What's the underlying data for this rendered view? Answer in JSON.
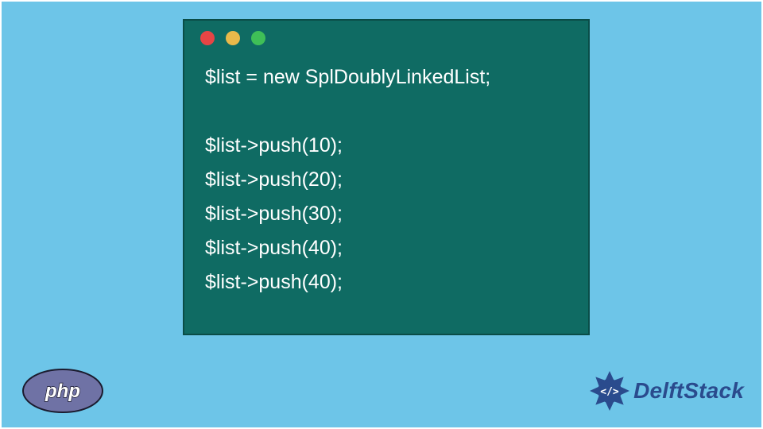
{
  "code": {
    "lines": [
      "$list = new SplDoublyLinkedList;",
      "",
      "$list->push(10);",
      "$list->push(20);",
      "$list->push(30);",
      "$list->push(40);",
      "$list->push(40);"
    ]
  },
  "badges": {
    "php_label": "php",
    "delft_label": "DelftStack"
  },
  "colors": {
    "canvas": "#6dc5e8",
    "window": "#0f6b63",
    "dot_red": "#e64545",
    "dot_yellow": "#e9b94a",
    "dot_green": "#3fbf57",
    "php_fill": "#6f72a5",
    "delft_blue": "#2a4b8d"
  }
}
